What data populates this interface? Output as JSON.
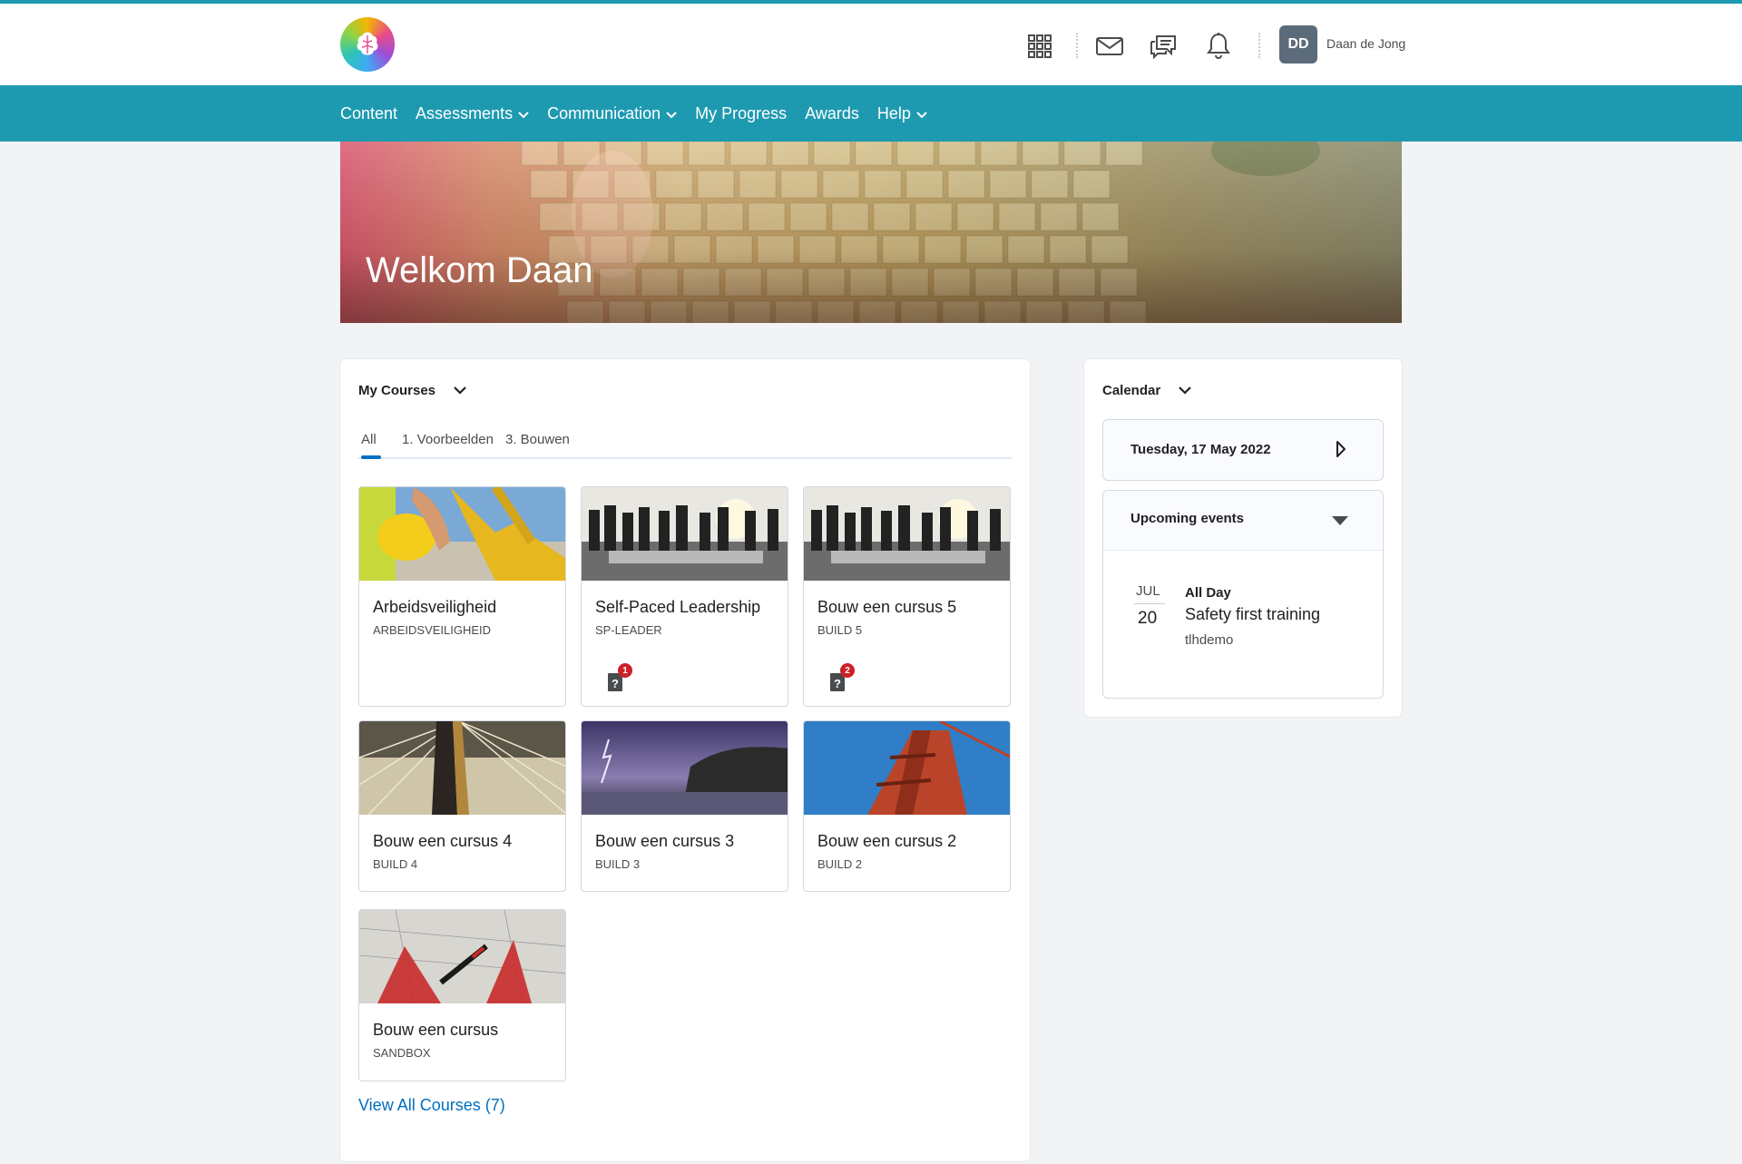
{
  "header": {
    "logo_icon": "brain-logo-icon",
    "icons": [
      "apps-grid-icon",
      "mail-icon",
      "chat-icon",
      "bell-icon"
    ],
    "user": {
      "initials": "DD",
      "name": "Daan de Jong"
    }
  },
  "nav": {
    "items": [
      {
        "label": "Content",
        "has_dropdown": false
      },
      {
        "label": "Assessments",
        "has_dropdown": true
      },
      {
        "label": "Communication",
        "has_dropdown": true
      },
      {
        "label": "My Progress",
        "has_dropdown": false
      },
      {
        "label": "Awards",
        "has_dropdown": false
      },
      {
        "label": "Help",
        "has_dropdown": true
      }
    ]
  },
  "hero": {
    "title": "Welkom Daan"
  },
  "courses": {
    "title": "My Courses",
    "tabs": [
      "All",
      "1. Voorbeelden",
      "3. Bouwen"
    ],
    "active_tab": "All",
    "cards": [
      {
        "title": "Arbeidsveiligheid",
        "code": "ARBEIDSVEILIGHEID",
        "image": "construction-helmet",
        "badge": null
      },
      {
        "title": "Self-Paced Leadership",
        "code": "SP-LEADER",
        "image": "office-silhouettes",
        "badge": "1"
      },
      {
        "title": "Bouw een cursus 5",
        "code": "BUILD 5",
        "image": "office-silhouettes",
        "badge": "2"
      },
      {
        "title": "Bouw een cursus 4",
        "code": "BUILD 4",
        "image": "bridge-cables",
        "badge": null
      },
      {
        "title": "Bouw een cursus 3",
        "code": "BUILD 3",
        "image": "lightning-storm",
        "badge": null
      },
      {
        "title": "Bouw een cursus 2",
        "code": "BUILD 2",
        "image": "red-bridge-tower",
        "badge": null
      },
      {
        "title": "Bouw een cursus",
        "code": "SANDBOX",
        "image": "drafting-tools",
        "badge": null
      }
    ],
    "view_all": "View All Courses (7)"
  },
  "calendar": {
    "title": "Calendar",
    "date": "Tuesday, 17 May 2022",
    "upcoming_title": "Upcoming events",
    "event": {
      "month": "JUL",
      "day": "20",
      "time": "All Day",
      "title": "Safety first training",
      "org": "tlhdemo"
    }
  },
  "colors": {
    "brand": "#1e9ab0",
    "link": "#006fbf",
    "badge": "#cd2026"
  }
}
